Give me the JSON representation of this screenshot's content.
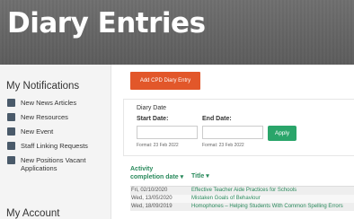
{
  "header": {
    "title": "Diary Entries"
  },
  "sidebar": {
    "notifications_heading": "My Notifications",
    "items": [
      {
        "label": "New News Articles",
        "icon": "square-badge-icon"
      },
      {
        "label": "New Resources",
        "icon": "square-badge-icon"
      },
      {
        "label": "New Event",
        "icon": "square-badge-icon"
      },
      {
        "label": "Staff Linking Requests",
        "icon": "square-badge-icon"
      },
      {
        "label": "New Positions Vacant Applications",
        "icon": "square-badge-icon"
      }
    ],
    "account_heading": "My Account"
  },
  "actions": {
    "add_label": "Add CPD Diary Entry"
  },
  "filter": {
    "title": "Diary Date",
    "start_label": "Start Date:",
    "end_label": "End Date:",
    "start_format": "Format: 23 Feb 2022",
    "end_format": "Format: 23 Feb 2022",
    "apply_label": "Apply"
  },
  "table": {
    "col1": "Activity completion date",
    "col2": "Title",
    "rows": [
      {
        "date": "Fri, 02/10/2020",
        "title": "Effective Teacher Aide Practices for Schools"
      },
      {
        "date": "Wed, 13/05/2020",
        "title": "Mistaken Goals of Behaviour"
      },
      {
        "date": "Wed, 18/09/2019",
        "title": "Homophones – Helping Students With Common Spelling Errors"
      }
    ]
  },
  "colors": {
    "accent": "#e2572a",
    "link": "#2a8a5c",
    "apply": "#2aa56a"
  }
}
